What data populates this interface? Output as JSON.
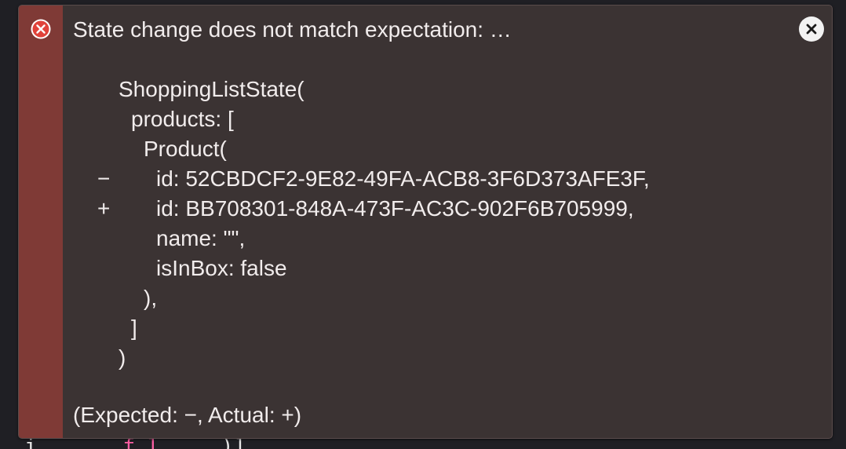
{
  "error": {
    "title": "State change does not match expectation: …",
    "footer": "(Expected: −, Actual: +)",
    "diff_lines": [
      {
        "marker": "",
        "text": "ShoppingListState(",
        "indent": 0
      },
      {
        "marker": "",
        "text": "products: [",
        "indent": 1
      },
      {
        "marker": "",
        "text": "Product(",
        "indent": 2
      },
      {
        "marker": "−",
        "text": "id: 52CBDCF2-9E82-49FA-ACB8-3F6D373AFE3F,",
        "indent": 3
      },
      {
        "marker": "+",
        "text": "id: BB708301-848A-473F-AC3C-902F6B705999,",
        "indent": 3
      },
      {
        "marker": "",
        "text": "name: \"\",",
        "indent": 3
      },
      {
        "marker": "",
        "text": "isInBox: false",
        "indent": 3
      },
      {
        "marker": "",
        "text": "),",
        "indent": 2
      },
      {
        "marker": "",
        "text": "]",
        "indent": 1
      },
      {
        "marker": "",
        "text": ")",
        "indent": 0
      }
    ]
  },
  "icons": {
    "error": "error-circle-x-icon",
    "close": "close-icon"
  },
  "colors": {
    "panel_background": "#3b3333",
    "gutter": "#7f3a36",
    "text": "#f1ecec",
    "error_icon": "#e0423a",
    "close_button": "#f2f2f2"
  }
}
